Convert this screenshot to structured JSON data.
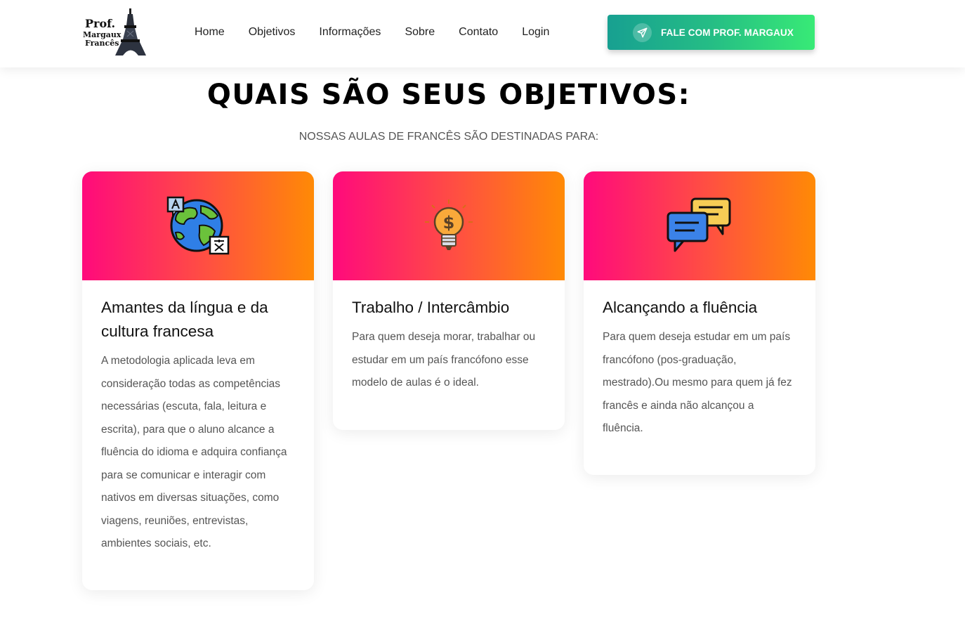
{
  "header": {
    "logo": {
      "line1": "Prof.",
      "line2": "Margaux",
      "line3": "Francês",
      "icon": "eiffel-tower-icon"
    },
    "nav": [
      "Home",
      "Objetivos",
      "Informações",
      "Sobre",
      "Contato",
      "Login"
    ],
    "cta": {
      "label": "FALE COM PROF. MARGAUX",
      "icon": "telegram-send-icon"
    }
  },
  "section": {
    "title": "QUAIS SÃO SEUS OBJETIVOS:",
    "subtitle": "NOSSAS AULAS DE FRANCÊS SÃO DESTINADAS PARA:"
  },
  "cards": [
    {
      "icon": "globe-translate-icon",
      "title": "Amantes da língua e da cultura francesa",
      "text": "A metodologia aplicada leva em consideração todas as competências necessárias (escuta, fala, leitura e escrita), para que o aluno alcance a fluência do idioma e adquira confiança para se comunicar e interagir com nativos em diversas situações, como viagens, reuniões, entrevistas, ambientes sociais, etc."
    },
    {
      "icon": "money-lightbulb-icon",
      "title": "Trabalho / Intercâmbio",
      "text": "Para quem deseja morar, trabalhar ou estudar em um país francófono esse modelo de aulas é o ideal."
    },
    {
      "icon": "chat-bubbles-icon",
      "title": "Alcançando a fluência",
      "text": "Para quem deseja estudar em um país francófono (pos-graduação, mestrado).Ou mesmo para quem já fez francês e ainda não alcançou a fluência."
    }
  ],
  "colors": {
    "banner_gradient": [
      "#ff0a7c",
      "#ff8a05"
    ],
    "cta_gradient": [
      "#17a091",
      "#38ea76"
    ]
  }
}
